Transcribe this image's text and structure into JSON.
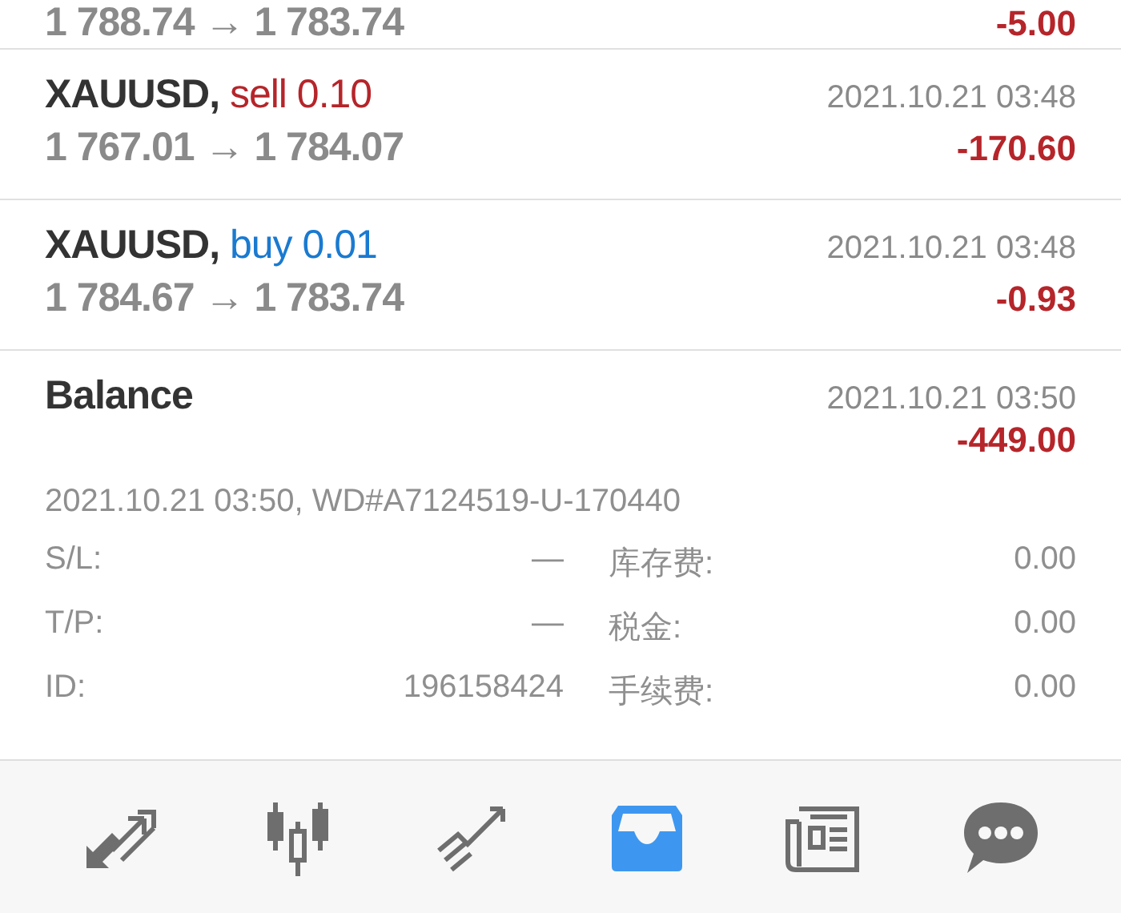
{
  "history": [
    {
      "kind": "tail",
      "prices": "1 788.74 → 1 783.74",
      "profit": "-5.00"
    },
    {
      "kind": "trade",
      "symbol": "XAUUSD,",
      "side": "sell",
      "volume": "0.10",
      "prices": "1 767.01 → 1 784.07",
      "time": "2021.10.21 03:48",
      "profit": "-170.60"
    },
    {
      "kind": "trade",
      "symbol": "XAUUSD,",
      "side": "buy",
      "volume": "0.01",
      "prices": "1 784.67 → 1 783.74",
      "time": "2021.10.21 03:48",
      "profit": "-0.93"
    },
    {
      "kind": "balance",
      "title": "Balance",
      "time": "2021.10.21 03:50",
      "profit": "-449.00",
      "comment": "2021.10.21 03:50, WD#A7124519-U-170440",
      "details": [
        {
          "label": "S/L:",
          "value": "—",
          "label2": "库存费:",
          "value2": "0.00"
        },
        {
          "label": "T/P:",
          "value": "—",
          "label2": "税金:",
          "value2": "0.00"
        },
        {
          "label": "ID:",
          "value": "196158424",
          "label2": "手续费:",
          "value2": "0.00"
        }
      ]
    }
  ],
  "nav": [
    {
      "selected": false
    },
    {
      "selected": false
    },
    {
      "selected": false
    },
    {
      "selected": true
    },
    {
      "selected": false
    },
    {
      "selected": false
    }
  ]
}
